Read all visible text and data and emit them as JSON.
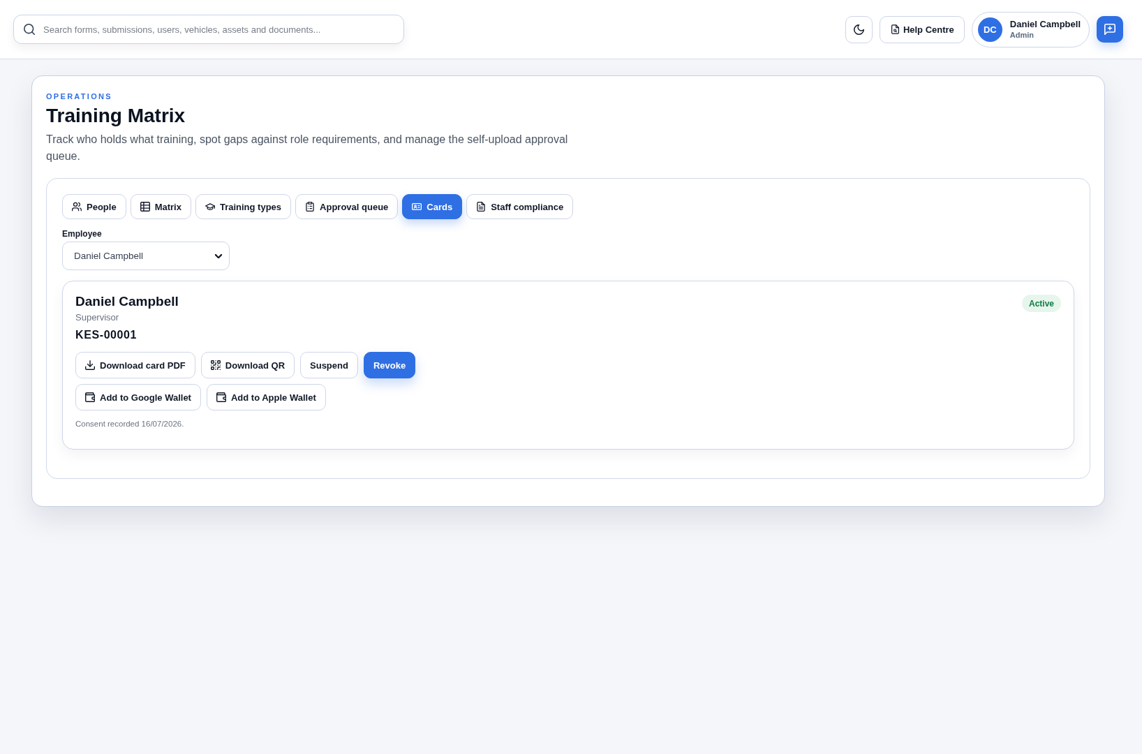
{
  "top_bar": {
    "search": {
      "placeholder": "Search forms, submissions, users, vehicles, assets and documents..."
    },
    "help_label": "Help Centre",
    "user": {
      "initials": "DC",
      "name": "Daniel Campbell",
      "role": "Admin"
    }
  },
  "page_header": {
    "eyebrow": "OPERATIONS",
    "title": "Training Matrix",
    "description": "Track who holds what training, spot gaps against role requirements, and manage the self-upload approval queue."
  },
  "tabs": [
    {
      "label": "People",
      "selected": false
    },
    {
      "label": "Matrix",
      "selected": false
    },
    {
      "label": "Training types",
      "selected": false
    },
    {
      "label": "Approval queue",
      "selected": false
    },
    {
      "label": "Cards",
      "selected": true
    },
    {
      "label": "Staff compliance",
      "selected": false
    }
  ],
  "employee_select": {
    "label": "Employee",
    "value": "Daniel Campbell"
  },
  "card": {
    "name": "Daniel Campbell",
    "role": "Supervisor",
    "card_number": "KES-00001",
    "status": {
      "label": "Active",
      "kind": "active"
    },
    "action_rows": [
      [
        {
          "label": "Download card PDF",
          "kind": "pdf"
        },
        {
          "label": "Download QR",
          "kind": "qr"
        },
        {
          "label": "Suspend",
          "kind": "suspend"
        },
        {
          "label": "Revoke",
          "kind": "revoke"
        }
      ],
      [
        {
          "label": "Add to Google Wallet",
          "kind": "wallet"
        },
        {
          "label": "Add to Apple Wallet",
          "kind": "wallet"
        }
      ]
    ],
    "consent_note": "Consent recorded 16/07/2026."
  }
}
